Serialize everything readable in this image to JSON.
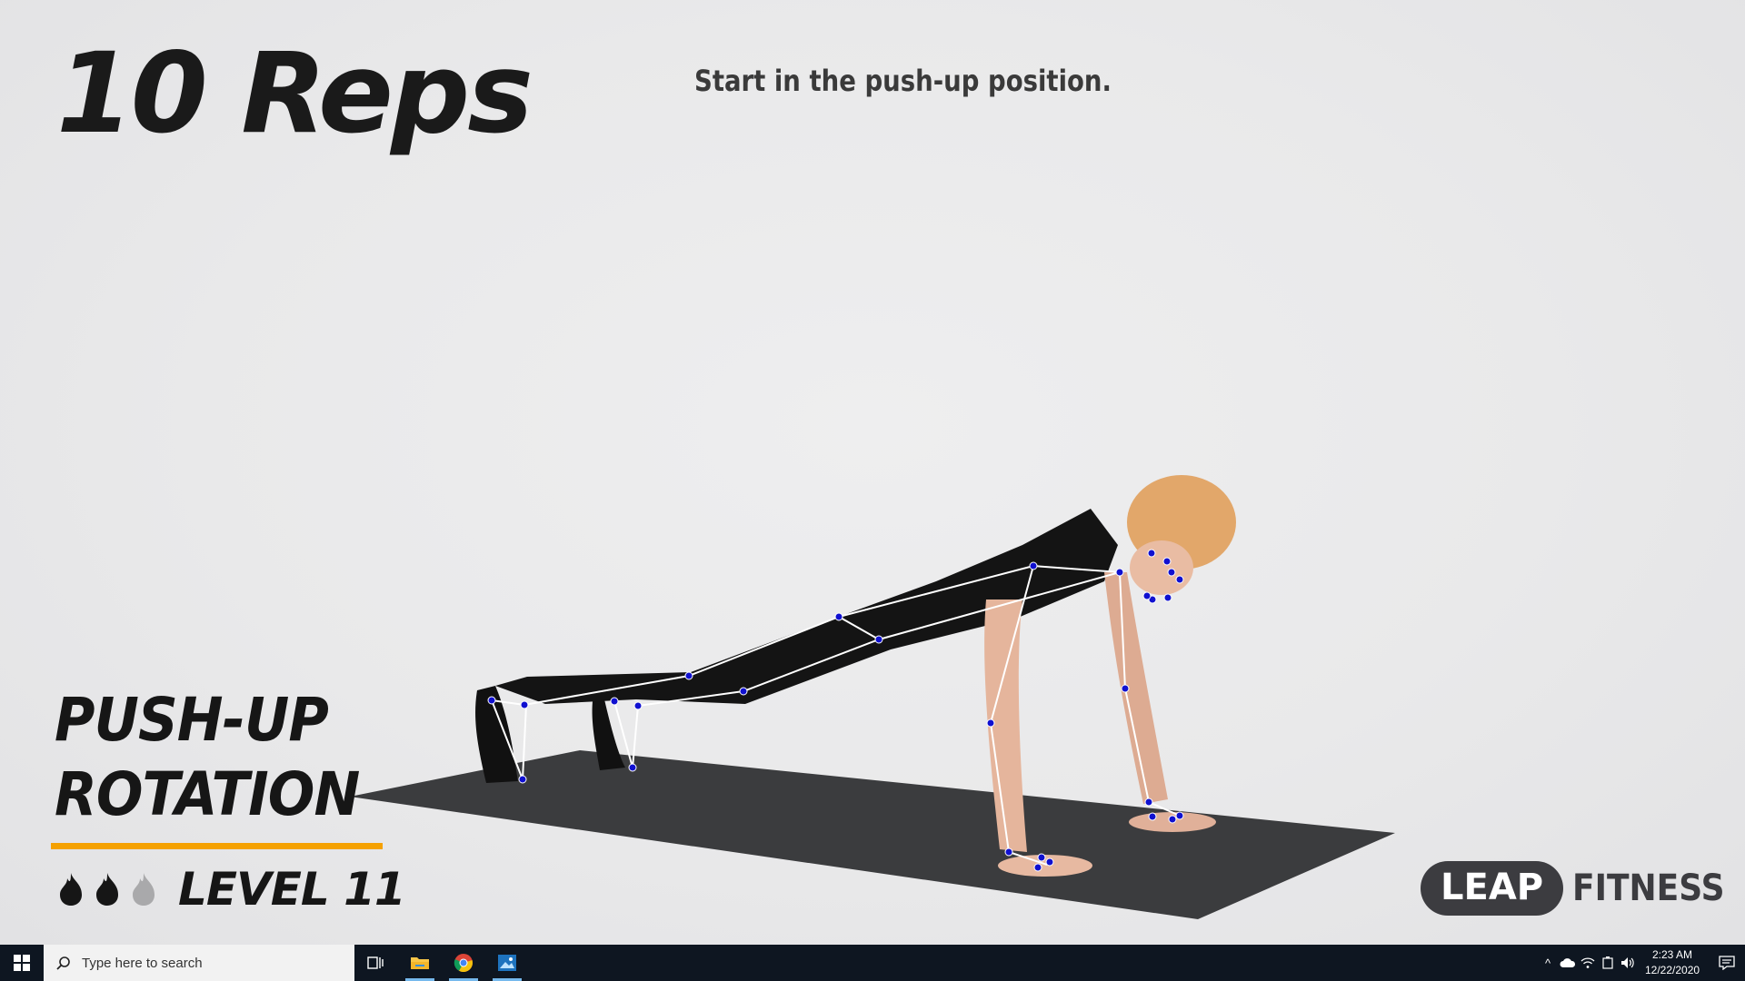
{
  "video": {
    "reps": "10 Reps",
    "instruction": "Start in the push-up position.",
    "exercise_name": [
      "PUSH-UP",
      "ROTATION"
    ],
    "level": "LEVEL 11",
    "difficulty": {
      "filled": 2,
      "total": 3
    },
    "brand": {
      "pill": "LEAP",
      "rest": "FITNESS"
    },
    "colors": {
      "accent": "#f5a100",
      "keypoint": "#1010d0",
      "skeleton": "#ffffff",
      "mat": "#3b3c3e"
    }
  },
  "taskbar": {
    "search_placeholder": "Type here to search",
    "apps": [
      "task-view",
      "file-explorer",
      "chrome",
      "photos"
    ],
    "clock_time": "2:23 AM",
    "clock_date": "12/22/2020"
  }
}
